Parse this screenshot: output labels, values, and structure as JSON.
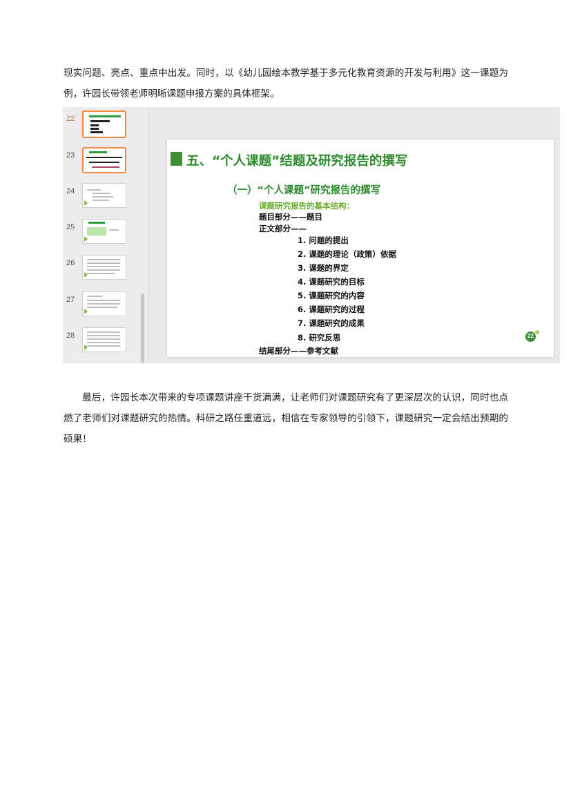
{
  "article": {
    "para1": "现实问题、亮点、重点中出发。同时，以《幼儿园绘本教学基于多元化教育资源的开发与利用》这一课题为例，许园长带领老师明晰课题申报方案的具体框架。",
    "para2": "最后，许园长本次带来的专项课题讲座干货满满，让老师们对课题研究有了更深层次的认识，同时也点燃了老师们对课题研究的热情。科研之路任重道远，相信在专家领导的引领下，课题研究一定会结出预期的硕果！"
  },
  "ppt": {
    "thumbnails": [
      {
        "num": "22"
      },
      {
        "num": "23"
      },
      {
        "num": "24"
      },
      {
        "num": "25"
      },
      {
        "num": "26"
      },
      {
        "num": "27"
      },
      {
        "num": "28"
      }
    ],
    "slide": {
      "title": "五、“个人课题”结题及研究报告的撰写",
      "subtitle": "（一）“个人课题”研究报告的撰写",
      "heading": "课题研究报告的基本结构：",
      "lines": [
        "题目部分——题目",
        "正文部分——",
        "1. 问题的提出",
        "2. 课题的理论（政策）依据",
        "3. 课题的界定",
        "4. 课题研究的目标",
        "5. 课题研究的内容",
        "6. 课题研究的过程",
        "7. 课题研究的成果",
        "8. 研究反思",
        "结尾部分——参考文献"
      ],
      "logo_text": "22"
    },
    "colors": {
      "title_green": "#2e8a2e",
      "heading_green": "#6fae2e",
      "active_orange": "#e07a2c",
      "bar_green": "#3f8f34"
    }
  }
}
